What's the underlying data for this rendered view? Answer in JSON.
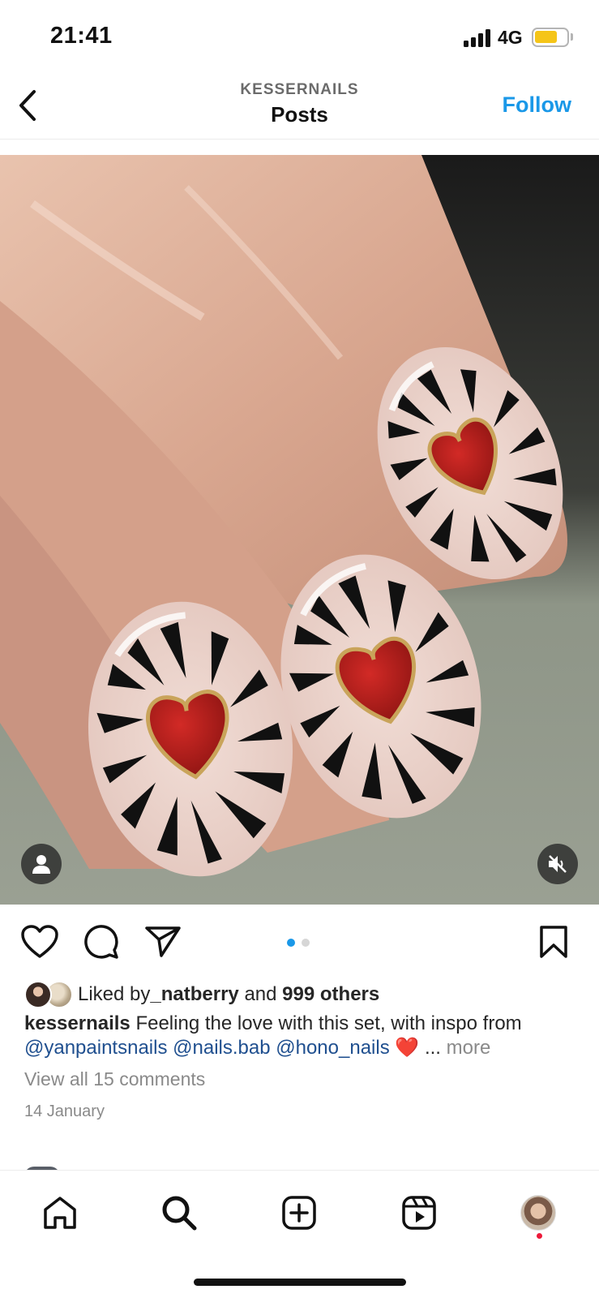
{
  "status_bar": {
    "time": "21:41",
    "network": "4G",
    "battery_level": 0.6,
    "battery_color": "#f5c518"
  },
  "header": {
    "username": "KESSERNAILS",
    "title": "Posts",
    "follow_label": "Follow",
    "accent_color": "#1a98e8"
  },
  "media": {
    "carousel_pages": 2,
    "carousel_active": 1
  },
  "actions": {
    "like_icon": "heart-icon",
    "comment_icon": "comment-icon",
    "share_icon": "send-icon",
    "save_icon": "bookmark-icon"
  },
  "likes": {
    "prefix": "Liked by ",
    "user": "_natberry",
    "middle": " and ",
    "others": "999 others"
  },
  "caption": {
    "author": "kessernails",
    "text": " Feeling the love with this set, with inspo from ",
    "mentions": [
      "@yanpaintsnails",
      "@nails.bab",
      "@hono_nails"
    ],
    "emoji": "❤️",
    "ellipsis": "... ",
    "more_label": "more"
  },
  "comments_link": "View all 15 comments",
  "date": "14 January",
  "bottom_nav": {
    "tabs": [
      "home-icon",
      "search-icon",
      "create-icon",
      "reels-icon",
      "profile-avatar"
    ]
  }
}
